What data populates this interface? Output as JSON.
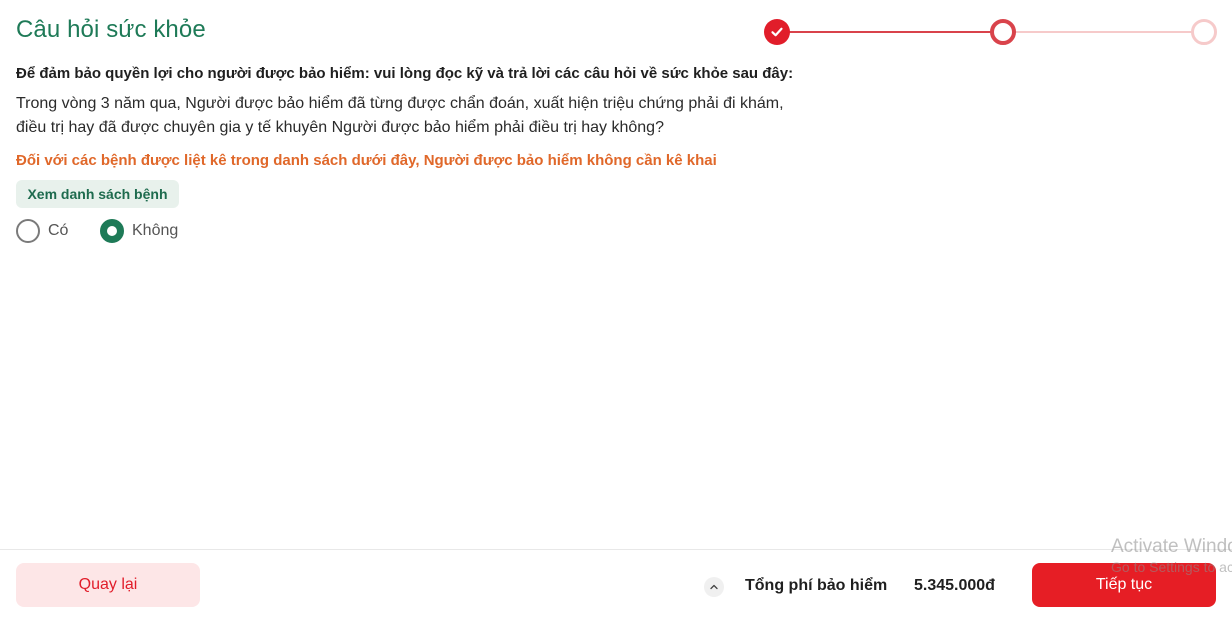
{
  "page": {
    "title": "Câu hỏi sức khỏe"
  },
  "stepper": {
    "steps": [
      {
        "state": "completed",
        "icon": "check-icon"
      },
      {
        "state": "current"
      },
      {
        "state": "upcoming"
      }
    ]
  },
  "question": {
    "intro": "Để đảm bảo quyền lợi cho người được bảo hiểm: vui lòng đọc kỹ và trả lời các câu hỏi về sức khỏe sau đây:",
    "text": "Trong vòng 3 năm qua, Người được bảo hiểm đã từng được chẩn đoán, xuất hiện triệu chứng phải đi khám, điều trị hay đã được chuyên gia y tế khuyên Người được bảo hiểm phải điều trị hay không?",
    "note": "Đối với các bệnh được liệt kê trong danh sách dưới đây, Người được bảo hiểm không cần kê khai",
    "disease_list_button": "Xem danh sách bệnh",
    "options": [
      {
        "label": "Có",
        "selected": false
      },
      {
        "label": "Không",
        "selected": true
      }
    ]
  },
  "footer": {
    "back_label": "Quay lại",
    "expand_icon": "chevron-up-icon",
    "fee_label": "Tổng phí bảo hiểm",
    "fee_value": "5.345.000đ",
    "next_label": "Tiếp tục"
  },
  "watermark": {
    "title": "Activate Windows",
    "subtitle": "Go to Settings to activate Windows."
  },
  "colors": {
    "brand_green": "#1e7a57",
    "accent_red": "#e61e25",
    "note_orange": "#e0682a"
  }
}
